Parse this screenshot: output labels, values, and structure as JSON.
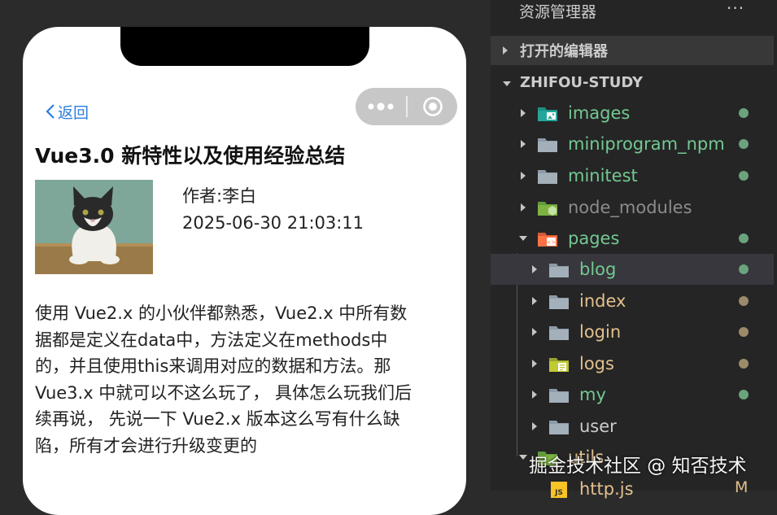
{
  "simulator": {
    "back_label": "返回",
    "article": {
      "title": "Vue3.0 新特性以及使用经验总结",
      "author": "作者:李白",
      "time": "2025-06-30 21:03:11",
      "content_lines": [
        "使用 Vue2.x 的小伙伴都熟悉，Vue2.x 中所有数",
        "据都是定义在data中，方法定义在methods中",
        "的，并且使用this来调用对应的数据和方法。那",
        "Vue3.x 中就可以不这么玩了， 具体怎么玩我们后",
        "续再说， 先说一下 Vue2.x 版本这么写有什么缺",
        "陷，所有才会进行升级变更的"
      ]
    }
  },
  "explorer": {
    "title": "资源管理器",
    "more": "···",
    "open_editors": "打开的编辑器",
    "project": "ZHIFOU-STUDY",
    "items": [
      {
        "label": "images",
        "icon": "image-folder-icon",
        "color": "#73c991",
        "dot": "#6aa37c",
        "level": 1,
        "expanded": false
      },
      {
        "label": "miniprogram_npm",
        "icon": "folder-icon",
        "color": "#73c991",
        "dot": "#6aa37c",
        "level": 1,
        "expanded": false
      },
      {
        "label": "minitest",
        "icon": "folder-icon",
        "color": "#73c991",
        "dot": "#6aa37c",
        "level": 1,
        "expanded": false
      },
      {
        "label": "node_modules",
        "icon": "node-folder-icon",
        "color": "#8c8c8c",
        "dot": "",
        "level": 1,
        "expanded": false
      },
      {
        "label": "pages",
        "icon": "pages-folder-icon",
        "color": "#73c991",
        "dot": "#6aa37c",
        "level": 1,
        "expanded": true
      },
      {
        "label": "blog",
        "icon": "folder-icon",
        "color": "#73c991",
        "dot": "#6aa37c",
        "level": 2,
        "expanded": false,
        "selected": true
      },
      {
        "label": "index",
        "icon": "folder-icon",
        "color": "#e2c08d",
        "dot": "#9c8a6a",
        "level": 2,
        "expanded": false
      },
      {
        "label": "login",
        "icon": "folder-icon",
        "color": "#e2c08d",
        "dot": "#9c8a6a",
        "level": 2,
        "expanded": false
      },
      {
        "label": "logs",
        "icon": "logs-folder-icon",
        "color": "#e2c08d",
        "dot": "#9c8a6a",
        "level": 2,
        "expanded": false
      },
      {
        "label": "my",
        "icon": "folder-icon",
        "color": "#73c991",
        "dot": "#6aa37c",
        "level": 2,
        "expanded": false
      },
      {
        "label": "user",
        "icon": "folder-icon",
        "color": "#cccccc",
        "dot": "",
        "level": 2,
        "expanded": false
      },
      {
        "label": "utils",
        "icon": "utils-folder-icon",
        "color": "#e2c08d",
        "dot": "",
        "level": 1,
        "expanded": true
      },
      {
        "label": "http.js",
        "icon": "js-file-icon",
        "color": "#e2c08d",
        "dot": "",
        "level": 2,
        "expanded": false,
        "status": "M"
      }
    ]
  },
  "watermark": "掘金技术社区 @ 知否技术"
}
